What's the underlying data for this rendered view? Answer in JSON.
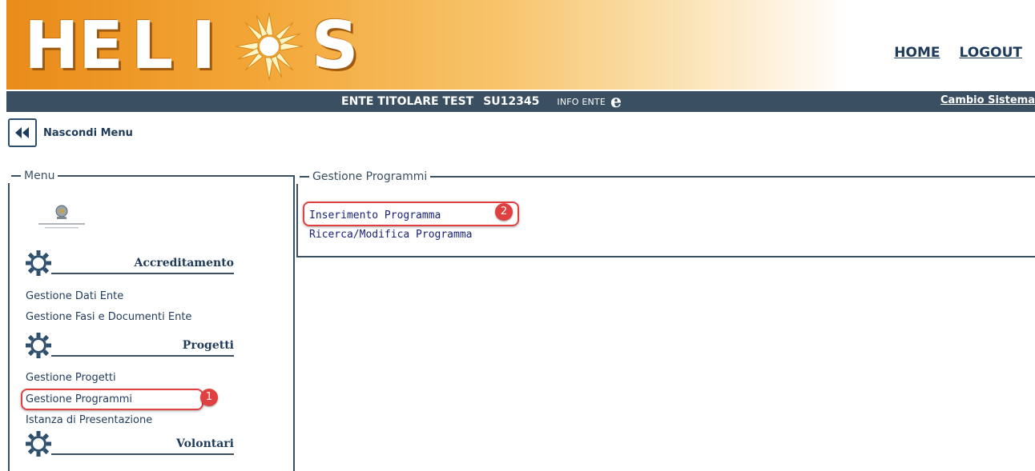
{
  "header": {
    "logo_letters": [
      "H",
      "E",
      "L",
      "I",
      "S"
    ],
    "nav": {
      "home": "HOME",
      "logout": "LOGOUT"
    }
  },
  "infobar": {
    "entity_name": "ENTE TITOLARE TEST",
    "entity_code": "SU12345",
    "info_label": "INFO ENTE",
    "e_icon": "e",
    "cambio_sistema": "Cambio Sistema"
  },
  "hide_menu": {
    "label": "Nascondi Menu",
    "icon": "double-chevron-left-icon"
  },
  "menu": {
    "legend": "Menu",
    "sections": [
      {
        "title": "Accreditamento",
        "items": [
          "Gestione Dati Ente",
          "Gestione Fasi e Documenti Ente"
        ]
      },
      {
        "title": "Progetti",
        "items": [
          "Gestione Progetti",
          "Gestione Programmi",
          "Istanza di Presentazione"
        ]
      },
      {
        "title": "Volontari",
        "items": []
      }
    ]
  },
  "content": {
    "legend": "Gestione Programmi",
    "links": [
      "Inserimento Programma",
      "Ricerca/Modifica Programma"
    ]
  },
  "annotations": {
    "badge_1": "1",
    "badge_2": "2"
  },
  "colors": {
    "accent": "#3b4f63",
    "link": "#1a237e",
    "highlight": "#e0403f",
    "header_orange": "#e98b19"
  }
}
